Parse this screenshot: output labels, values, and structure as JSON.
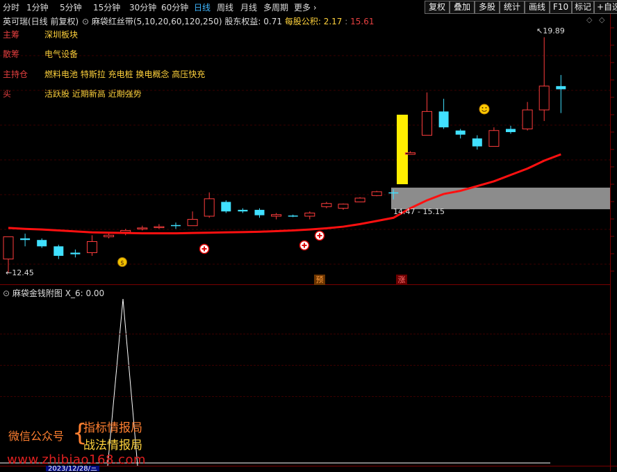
{
  "toolbar": {
    "periods": [
      "分时",
      "1分钟",
      "5分钟",
      "15分钟",
      "30分钟",
      "60分钟",
      "日线",
      "周线",
      "月线",
      "多周期",
      "更多"
    ],
    "active_period": "日线",
    "buttons": [
      "复权",
      "叠加",
      "多股",
      "统计",
      "画线",
      "F10",
      "标记",
      "+自选"
    ]
  },
  "info_bar": {
    "stock_title": "英可瑞(日线 前复权)",
    "indicator_name": "麻袋红丝带(5,10,20,60,120,250)",
    "holder_label": "股东权益:",
    "holder_value": "0.71",
    "per_share_label": "每股公积:",
    "per_share_value": "2.17",
    "extra_value": "15.61"
  },
  "overlay_rows": [
    {
      "key": "主筹",
      "value": "深圳板块"
    },
    {
      "key": "散筹",
      "value": "电气设备"
    },
    {
      "key": "主持仓",
      "value": "燃料电池 特斯拉 充电桩 换电概念 高压快充"
    },
    {
      "key": "买",
      "value": "活跃股 近期新高 近期强势"
    }
  ],
  "main_chart": {
    "high_label": "19.89",
    "low_label": "12.45",
    "zone_label": "14.47 - 15.15",
    "markers": [
      "预",
      "涨"
    ],
    "colors": {
      "up": "#ff3d3d",
      "down": "#40e0ff",
      "ma": "#ff1010",
      "zone": "#8c8c8c",
      "bar": "#ffee00"
    }
  },
  "chart_data": {
    "type": "candlestick",
    "candles": [
      {
        "o": 13.6,
        "h": 13.6,
        "l": 12.45,
        "c": 12.9,
        "up": true
      },
      {
        "o": 13.55,
        "h": 13.7,
        "l": 13.3,
        "c": 13.5,
        "up": false
      },
      {
        "o": 13.5,
        "h": 13.55,
        "l": 13.25,
        "c": 13.3,
        "up": false
      },
      {
        "o": 13.3,
        "h": 13.35,
        "l": 12.9,
        "c": 13.0,
        "up": false
      },
      {
        "o": 13.1,
        "h": 13.2,
        "l": 12.95,
        "c": 13.05,
        "up": false
      },
      {
        "o": 13.1,
        "h": 13.65,
        "l": 13.0,
        "c": 13.45,
        "up": true
      },
      {
        "o": 13.6,
        "h": 13.75,
        "l": 13.55,
        "c": 13.65,
        "up": true
      },
      {
        "o": 13.75,
        "h": 13.85,
        "l": 13.65,
        "c": 13.8,
        "up": true
      },
      {
        "o": 13.85,
        "h": 13.95,
        "l": 13.8,
        "c": 13.88,
        "up": true
      },
      {
        "o": 13.9,
        "h": 14.0,
        "l": 13.85,
        "c": 13.92,
        "up": true
      },
      {
        "o": 13.95,
        "h": 14.05,
        "l": 13.85,
        "c": 13.97,
        "up": false
      },
      {
        "o": 13.95,
        "h": 14.4,
        "l": 13.95,
        "c": 14.15,
        "up": true
      },
      {
        "o": 14.25,
        "h": 15.0,
        "l": 14.2,
        "c": 14.8,
        "up": true
      },
      {
        "o": 14.7,
        "h": 14.75,
        "l": 14.35,
        "c": 14.4,
        "up": false
      },
      {
        "o": 14.4,
        "h": 14.5,
        "l": 14.35,
        "c": 14.45,
        "up": false
      },
      {
        "o": 14.45,
        "h": 14.5,
        "l": 14.2,
        "c": 14.28,
        "up": false
      },
      {
        "o": 14.25,
        "h": 14.35,
        "l": 14.15,
        "c": 14.3,
        "up": true
      },
      {
        "o": 14.25,
        "h": 14.3,
        "l": 14.22,
        "c": 14.27,
        "up": false
      },
      {
        "o": 14.25,
        "h": 14.4,
        "l": 14.15,
        "c": 14.35,
        "up": true
      },
      {
        "o": 14.55,
        "h": 14.7,
        "l": 14.5,
        "c": 14.65,
        "up": true
      },
      {
        "o": 14.5,
        "h": 14.65,
        "l": 14.45,
        "c": 14.63,
        "up": true
      },
      {
        "o": 14.7,
        "h": 14.85,
        "l": 14.7,
        "c": 14.82,
        "up": true
      },
      {
        "o": 14.9,
        "h": 15.05,
        "l": 14.88,
        "c": 15.02,
        "up": true
      },
      {
        "o": 15.0,
        "h": 15.1,
        "l": 14.78,
        "c": 15.0,
        "up": false
      },
      {
        "o": 16.2,
        "h": 16.3,
        "l": 16.2,
        "c": 16.25,
        "up": true
      },
      {
        "o": 17.55,
        "h": 18.15,
        "l": 16.9,
        "c": 16.8,
        "up": true
      },
      {
        "o": 17.55,
        "h": 17.95,
        "l": 17.0,
        "c": 17.05,
        "up": false
      },
      {
        "o": 16.95,
        "h": 17.0,
        "l": 16.7,
        "c": 16.82,
        "up": false
      },
      {
        "o": 16.7,
        "h": 16.8,
        "l": 16.35,
        "c": 16.45,
        "up": false
      },
      {
        "o": 16.45,
        "h": 17.05,
        "l": 16.45,
        "c": 16.95,
        "up": true
      },
      {
        "o": 17.0,
        "h": 17.1,
        "l": 16.85,
        "c": 16.9,
        "up": false
      },
      {
        "o": 17.0,
        "h": 17.85,
        "l": 16.95,
        "c": 17.6,
        "up": true
      },
      {
        "o": 17.6,
        "h": 19.89,
        "l": 17.25,
        "c": 18.35,
        "up": true
      },
      {
        "o": 18.35,
        "h": 18.7,
        "l": 17.5,
        "c": 18.25,
        "up": false
      }
    ],
    "ma": [
      13.88,
      13.85,
      13.83,
      13.8,
      13.77,
      13.74,
      13.73,
      13.72,
      13.71,
      13.71,
      13.71,
      13.72,
      13.73,
      13.74,
      13.75,
      13.76,
      13.78,
      13.8,
      13.83,
      13.87,
      13.92,
      14.0,
      14.1,
      14.2,
      14.5,
      14.75,
      14.95,
      15.05,
      15.2,
      15.35,
      15.55,
      15.75,
      16.0,
      16.2
    ],
    "zone": [
      14.47,
      15.15
    ]
  },
  "sub_panel": {
    "title": "麻袋金钱附图",
    "series_label": "X_6:",
    "series_value": "0.00"
  },
  "watermark": {
    "platform": "微信公众号",
    "line1": "指标情报局",
    "line2": "战法情报局",
    "url": "www.zhibiao168.com"
  },
  "bottom": {
    "date": "2023/12/28/三"
  }
}
